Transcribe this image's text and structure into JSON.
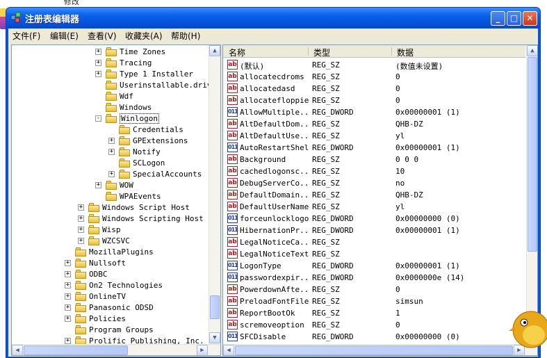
{
  "desktop": {
    "label": "修改"
  },
  "window": {
    "title": "注册表编辑器"
  },
  "menu": [
    "文件(F)",
    "编辑(E)",
    "查看(V)",
    "收藏夹(A)",
    "帮助(H)"
  ],
  "tree": [
    {
      "label": "Time Zones",
      "level": 3,
      "expander": "+"
    },
    {
      "label": "Tracing",
      "level": 3,
      "expander": "+"
    },
    {
      "label": "Type 1 Installer",
      "level": 3,
      "expander": "+"
    },
    {
      "label": "Userinstallable.drivers",
      "level": 3,
      "expander": ""
    },
    {
      "label": "Wdf",
      "level": 3,
      "expander": ""
    },
    {
      "label": "Windows",
      "level": 3,
      "expander": ""
    },
    {
      "label": "Winlogon",
      "level": 3,
      "expander": "-",
      "selected": true
    },
    {
      "label": "Credentials",
      "level": 4,
      "expander": ""
    },
    {
      "label": "GPExtensions",
      "level": 4,
      "expander": "+"
    },
    {
      "label": "Notify",
      "level": 4,
      "expander": "+"
    },
    {
      "label": "SCLogon",
      "level": 4,
      "expander": ""
    },
    {
      "label": "SpecialAccounts",
      "level": 4,
      "expander": "+"
    },
    {
      "label": "WOW",
      "level": 3,
      "expander": "+"
    },
    {
      "label": "WPAEvents",
      "level": 3,
      "expander": ""
    },
    {
      "label": "Windows Script Host",
      "level": 1,
      "expander": "+"
    },
    {
      "label": "Windows Scripting Host",
      "level": 1,
      "expander": "+"
    },
    {
      "label": "Wisp",
      "level": 1,
      "expander": "+"
    },
    {
      "label": "WZCSVC",
      "level": 1,
      "expander": "+"
    },
    {
      "label": "MozillaPlugins",
      "level": 0,
      "expander": ""
    },
    {
      "label": "Nullsoft",
      "level": 0,
      "expander": "+"
    },
    {
      "label": "ODBC",
      "level": 0,
      "expander": "+"
    },
    {
      "label": "On2 Technologies",
      "level": 0,
      "expander": "+"
    },
    {
      "label": "OnlineTV",
      "level": 0,
      "expander": "+"
    },
    {
      "label": "Panasonic ODSD",
      "level": 0,
      "expander": "+"
    },
    {
      "label": "Policies",
      "level": 0,
      "expander": "+"
    },
    {
      "label": "Program Groups",
      "level": 0,
      "expander": ""
    },
    {
      "label": "Prolific Publishing, Inc.",
      "level": 0,
      "expander": "+"
    }
  ],
  "columns": {
    "name": "名称",
    "type": "类型",
    "data": "数据"
  },
  "values": [
    {
      "name": "(默认)",
      "type": "REG_SZ",
      "data": "(数值未设置)",
      "kind": "sz"
    },
    {
      "name": "allocatecdroms",
      "type": "REG_SZ",
      "data": "0",
      "kind": "sz"
    },
    {
      "name": "allocatedasd",
      "type": "REG_SZ",
      "data": "0",
      "kind": "sz"
    },
    {
      "name": "allocatefloppies",
      "type": "REG_SZ",
      "data": "0",
      "kind": "sz"
    },
    {
      "name": "AllowMultiple...",
      "type": "REG_DWORD",
      "data": "0x00000001 (1)",
      "kind": "dword"
    },
    {
      "name": "AltDefaultDom...",
      "type": "REG_SZ",
      "data": "QHB-DZ",
      "kind": "sz"
    },
    {
      "name": "AltDefaultUse...",
      "type": "REG_SZ",
      "data": "yl",
      "kind": "sz"
    },
    {
      "name": "AutoRestartShell",
      "type": "REG_DWORD",
      "data": "0x00000001 (1)",
      "kind": "dword"
    },
    {
      "name": "Background",
      "type": "REG_SZ",
      "data": "0 0 0",
      "kind": "sz"
    },
    {
      "name": "cachedlogonsc...",
      "type": "REG_SZ",
      "data": "10",
      "kind": "sz"
    },
    {
      "name": "DebugServerCo...",
      "type": "REG_SZ",
      "data": "no",
      "kind": "sz"
    },
    {
      "name": "DefaultDomain...",
      "type": "REG_SZ",
      "data": "QHB-DZ",
      "kind": "sz"
    },
    {
      "name": "DefaultUserName",
      "type": "REG_SZ",
      "data": "yl",
      "kind": "sz"
    },
    {
      "name": "forceunlocklogon",
      "type": "REG_DWORD",
      "data": "0x00000000 (0)",
      "kind": "dword"
    },
    {
      "name": "HibernationPr...",
      "type": "REG_DWORD",
      "data": "0x00000001 (1)",
      "kind": "dword"
    },
    {
      "name": "LegalNoticeCa...",
      "type": "REG_SZ",
      "data": "",
      "kind": "sz"
    },
    {
      "name": "LegalNoticeText",
      "type": "REG_SZ",
      "data": "",
      "kind": "sz"
    },
    {
      "name": "LogonType",
      "type": "REG_DWORD",
      "data": "0x00000001 (1)",
      "kind": "dword"
    },
    {
      "name": "passwordexpir...",
      "type": "REG_DWORD",
      "data": "0x0000000e (14)",
      "kind": "dword"
    },
    {
      "name": "PowerdownAfte...",
      "type": "REG_SZ",
      "data": "0",
      "kind": "sz"
    },
    {
      "name": "PreloadFontFile",
      "type": "REG_SZ",
      "data": "simsun",
      "kind": "sz"
    },
    {
      "name": "ReportBootOk",
      "type": "REG_SZ",
      "data": "1",
      "kind": "sz"
    },
    {
      "name": "scremoveoption",
      "type": "REG_SZ",
      "data": "0",
      "kind": "sz"
    },
    {
      "name": "SFCDisable",
      "type": "REG_DWORD",
      "data": "0x00000000 (0)",
      "kind": "dword"
    }
  ],
  "icons": {
    "sz": "ab",
    "dword": "011"
  }
}
